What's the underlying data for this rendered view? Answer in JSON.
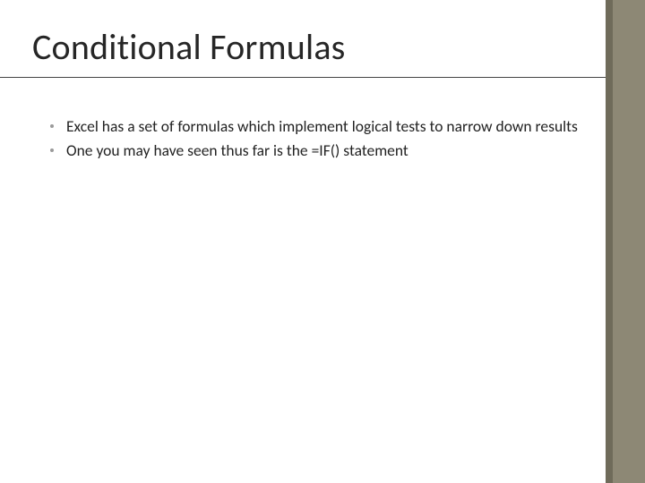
{
  "title": "Conditional Formulas",
  "bullets": [
    "Excel has a set of formulas which implement logical tests to narrow down results",
    "One you may have seen thus far is the =IF() statement"
  ],
  "colors": {
    "sidebar": "#8d8875",
    "sidebar_dark": "#6f6b5a",
    "text": "#262626"
  }
}
